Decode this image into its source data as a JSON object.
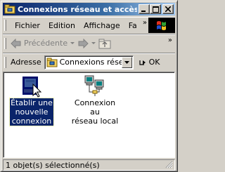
{
  "window": {
    "title": "Connexions réseau et accès ..."
  },
  "menu": {
    "items": [
      "Fichier",
      "Edition",
      "Affichage",
      "Fa"
    ],
    "overflow": "»"
  },
  "toolbar": {
    "back_label": "Précédente",
    "overflow": "»"
  },
  "address": {
    "label": "Adresse",
    "value": "Connexions réseau e",
    "go_label": "OK"
  },
  "items": [
    {
      "label_lines": [
        "Établir une",
        "nouvelle",
        "connexion"
      ],
      "selected": true,
      "icon": "new-connection-wizard-icon"
    },
    {
      "label_lines": [
        "Connexion au",
        "réseau local"
      ],
      "selected": false,
      "icon": "lan-connection-icon"
    }
  ],
  "status": {
    "text": "1 objet(s) sélectionné(s)"
  },
  "colors": {
    "titlebar_start": "#0a246a",
    "selection": "#0a246a",
    "face": "#d4d0c8"
  }
}
